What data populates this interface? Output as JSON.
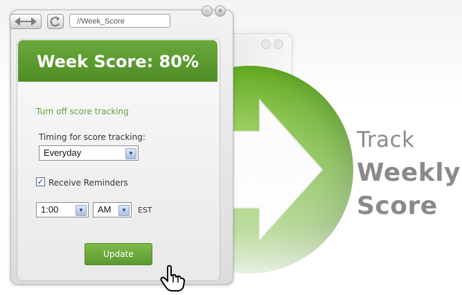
{
  "browser": {
    "address": "//Week_Score"
  },
  "panel": {
    "title": "Week Score: 80%",
    "turn_off_link": "Turn off score tracking",
    "timing_label": "Timing for score tracking:",
    "timing_value": "Everyday",
    "reminders_label": "Receive Reminders",
    "reminders_checked": true,
    "hour_value": "1:00",
    "ampm_value": "AM",
    "timezone": "EST",
    "update_label": "Update"
  },
  "headline": {
    "line1": "Track",
    "line2": "Weekly",
    "line3": "Score"
  },
  "icons": [
    "back-forward-icon",
    "refresh-icon",
    "minimize-icon",
    "close-icon",
    "arrow-icon",
    "hand-cursor-icon",
    "checkmark-icon",
    "chevron-down-icon"
  ],
  "colors": {
    "brand_green": "#5b9930",
    "header_green": "#5e9d31",
    "link_green": "#5fa040",
    "headline_gray": "#8a8a8a"
  }
}
